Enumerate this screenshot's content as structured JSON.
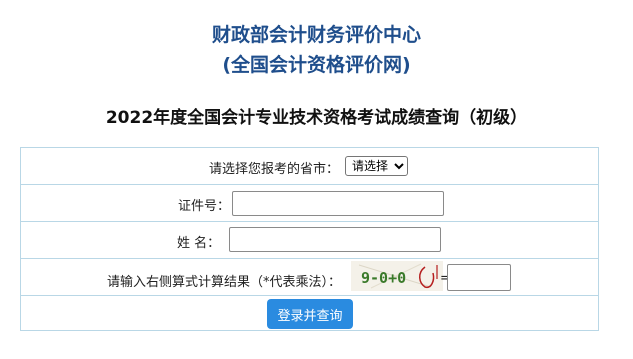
{
  "header": {
    "org_name": "财政部会计财务评价中心",
    "org_sub": "(全国会计资格评价网)",
    "exam_title": "2022年度全国会计专业技术资格考试成绩查询（初级）"
  },
  "form": {
    "province": {
      "label": "请选择您报考的省市：",
      "selected": "请选择"
    },
    "id_number": {
      "label": "证件号：",
      "value": ""
    },
    "name": {
      "label": "姓 名：",
      "value": ""
    },
    "captcha": {
      "label": "请输入右侧算式计算结果（*代表乘法）：",
      "image_text": "9-0+0",
      "equals": "=",
      "answer": ""
    },
    "submit_label": "登录并查询"
  },
  "colors": {
    "org_title": "#1f4e8c",
    "border": "#b9d7e6",
    "button": "#2a8be0"
  }
}
